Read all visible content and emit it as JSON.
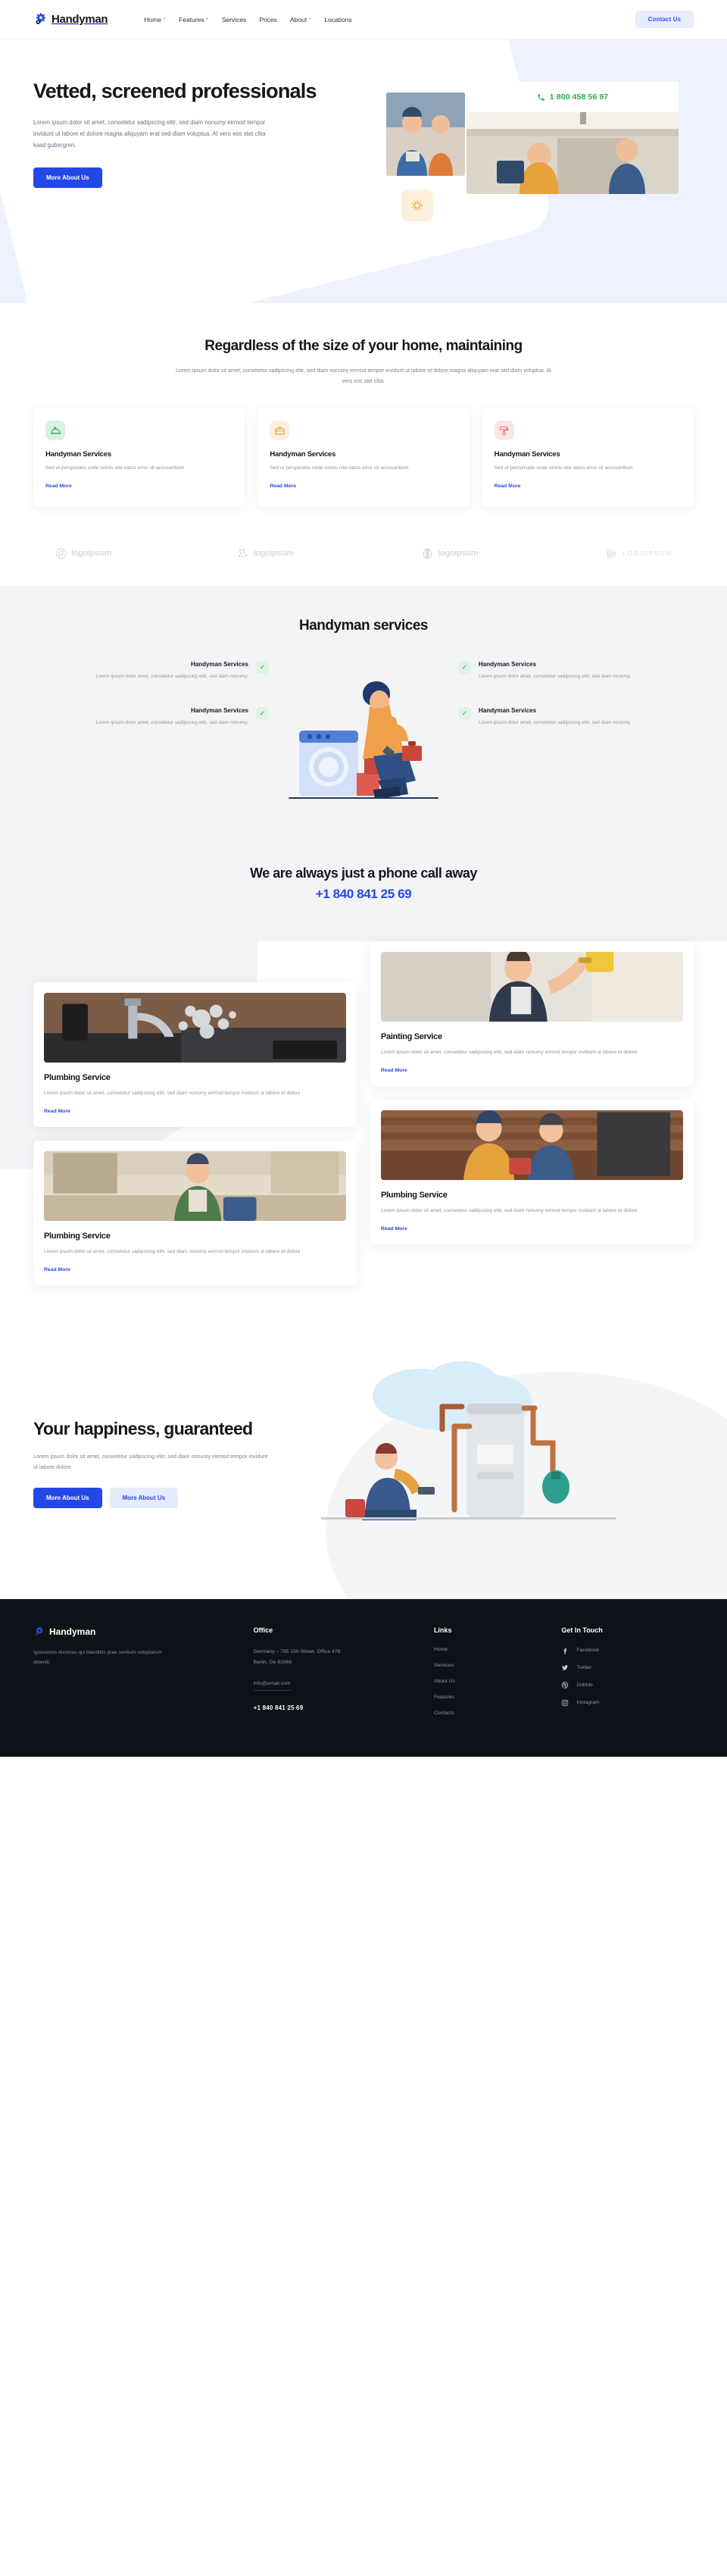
{
  "brand": {
    "name": "Handyman",
    "logo_icon": "gear-icon"
  },
  "nav": {
    "items": [
      {
        "label": "Home",
        "has_dropdown": true
      },
      {
        "label": "Features",
        "has_dropdown": true
      },
      {
        "label": "Services",
        "has_dropdown": false
      },
      {
        "label": "Prices",
        "has_dropdown": false
      },
      {
        "label": "About",
        "has_dropdown": true
      },
      {
        "label": "Locations",
        "has_dropdown": false
      }
    ],
    "cta": "Contact Us"
  },
  "hero": {
    "title": "Vetted, screened professionals",
    "body": "Lorem ipsum dolor sit amet, consetetur sadipscing elitr, sed diam nonumy eirmod tempor invidunt ut labore et dolore magna aliquyam erat sed diam voluptua. At vero eos stet clita kasd gubergren.",
    "cta": "More About Us",
    "phone": "1 800 458 56 97",
    "phone_icon": "phone-icon",
    "badge_icon": "sun-icon"
  },
  "services": {
    "title": "Regardless of the size of your home, maintaining",
    "lead": "Lorem ipsum dolor sit amet, consetetur sadipscing elitr, sed diam nonumy eirmod tempor invidunt ut labore et dolore magna aliquyam erat sed diam voluptua. At vero eos stet clita.",
    "cards": [
      {
        "icon": "hardhat-icon",
        "title": "Handyman Services",
        "body": "Sed ut perspiciatis unde omnis iste natus error sit accusantium",
        "link": "Read More"
      },
      {
        "icon": "toolbox-icon",
        "title": "Handyman Services",
        "body": "Sed ut perspiciatis unde omnis iste natus error sit accusantium",
        "link": "Read More"
      },
      {
        "icon": "paintroller-icon",
        "title": "Handyman Services",
        "body": "Sed ut perspiciatis unde omnis iste natus error sit accusantium",
        "link": "Read More"
      }
    ]
  },
  "logos": [
    {
      "label": "logoipsum",
      "mark": "circle-leaf-icon"
    },
    {
      "label": "logoipsum·",
      "mark": "dots-icon"
    },
    {
      "label": "logoipsum·",
      "mark": "half-circle-icon"
    },
    {
      "label": "LOGOIPSUM",
      "mark": "bars-icon"
    }
  ],
  "features": {
    "title": "Handyman services",
    "left": [
      {
        "title": "Handyman Services",
        "body": "Lorem ipsum dolor amet, consetetur sadipscing elitr, sed diam nonumy.",
        "check": "check-icon"
      },
      {
        "title": "Handyman Services",
        "body": "Lorem ipsum dolor amet, consetetur sadipscing elitr, sed diam nonumy.",
        "check": "check-icon"
      }
    ],
    "right": [
      {
        "title": "Handyman Services",
        "body": "Lorem ipsum dolor amet, consetetur sadipscing elitr, sed diam nonumy.",
        "check": "check-icon"
      },
      {
        "title": "Handyman Services",
        "body": "Lorem ipsum dolor amet, consetetur sadipscing elitr, sed diam nonumy.",
        "check": "check-icon"
      }
    ]
  },
  "callaway": {
    "title": "We are always just a phone call away",
    "phone": "+1 840 841 25 69"
  },
  "blog": {
    "left": [
      {
        "image": "plumbing-tap-water-photo",
        "title": "Plumbing Service",
        "body": "Lorem ipsum dolor sit amet, consetetur sadipscing elitr, sed diam nonumy eirmod tempor invidunt ut labore et dolore",
        "link": "Read More"
      },
      {
        "image": "handyman-kitchen-photo",
        "title": "Plumbing Service",
        "body": "Lorem ipsum dolor sit amet, consetetur sadipscing elitr, sed diam nonumy eirmod tempor invidunt ut labore et dolore",
        "link": "Read More"
      }
    ],
    "right": [
      {
        "image": "painter-roller-photo",
        "title": "Painting Service",
        "body": "Lorem ipsum dolor sit amet, consetetur sadipscing elitr, sed diam nonumy eirmod tempor invidunt ut labore et dolore",
        "link": "Read More"
      },
      {
        "image": "two-workers-kitchen-photo",
        "title": "Plumbing Service",
        "body": "Lorem ipsum dolor sit amet, consetetur sadipscing elitr, sed diam nonumy eirmod tempor invidunt ut labore et dolore",
        "link": "Read More"
      }
    ]
  },
  "happiness": {
    "title": "Your happiness, guaranteed",
    "body": "Lorem ipsum dolor sit amet, consetetur sadipscing elitr, sed diam nonumy eirmod tempor invidunt ut labore dolore.",
    "primary_cta": "More About Us",
    "secondary_cta": "More About Us"
  },
  "footer": {
    "brand": "Handyman",
    "about": "Ignissimos ducimus qui blanditiis prae sentium voluptatum deleniti.",
    "office": {
      "heading": "Office",
      "address_line1": "Germany – 785 15h Street, Office 478",
      "address_line2": "Berlin, De 81566",
      "email": "info@email.com",
      "phone": "+1 840 841 25 69"
    },
    "links": {
      "heading": "Links",
      "items": [
        "Home",
        "Services",
        "About Us",
        "Features",
        "Contacts"
      ]
    },
    "social": {
      "heading": "Get In Touch",
      "items": [
        {
          "label": "Facebook",
          "icon": "facebook-icon"
        },
        {
          "label": "Twitter",
          "icon": "twitter-icon"
        },
        {
          "label": "Dribble",
          "icon": "dribbble-icon"
        },
        {
          "label": "Instagram",
          "icon": "instagram-icon"
        }
      ]
    }
  },
  "colors": {
    "accent": "#2348e8",
    "accent_soft": "#e8edfd",
    "green": "#22b14c",
    "hero_bg": "#eef2fd",
    "grey_bg": "#f3f4f6",
    "footer_bg": "#0e1117",
    "ink": "#15171c",
    "muted": "#8c93a2"
  }
}
